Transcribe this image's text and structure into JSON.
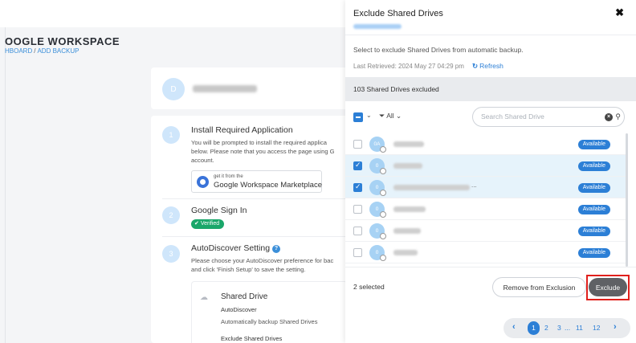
{
  "background": {
    "page_title": "OOGLE WORKSPACE",
    "breadcrumb": {
      "first": "HBOARD",
      "separator": "/",
      "second": "ADD BACKUP"
    },
    "user_avatar": "D",
    "steps": [
      {
        "num": "1",
        "title": "Install Required Application",
        "lines": [
          "You will be prompted to install the required applica",
          "below. Please note that you access the page using G",
          "account."
        ]
      },
      {
        "num": "2",
        "title": "Google Sign In",
        "badge": "Verified"
      },
      {
        "num": "3",
        "title": "AutoDiscover Setting",
        "lines": [
          "Please choose your AutoDiscover preference for bac",
          "and click 'Finish Setup' to save the setting."
        ]
      }
    ],
    "marketplace": {
      "small": "get it from the",
      "big": "Google Workspace Marketplace"
    },
    "shared_drive_card": {
      "title": "Shared Drive",
      "sub": "AutoDiscover",
      "desc": "Automatically backup Shared Drives",
      "exclude_label": "Exclude Shared Drives"
    }
  },
  "dialog": {
    "title": "Exclude Shared Drives",
    "close": "✖",
    "description": "Select to exclude Shared Drives from automatic backup.",
    "last_retrieved": "Last Retrieved: 2024 May 27 04:29 pm",
    "refresh_label": "Refresh",
    "excluded_summary": "103 Shared Drives excluded",
    "filter_label": "All",
    "search": {
      "placeholder": "Search Shared Drive",
      "value": ""
    },
    "rows": [
      {
        "initials": "0A",
        "selected": false,
        "status": "Available"
      },
      {
        "initials": "0",
        "selected": true,
        "status": "Available"
      },
      {
        "initials": "0",
        "selected": true,
        "status": "Available",
        "ellipsis": "..."
      },
      {
        "initials": "0",
        "selected": false,
        "status": "Available"
      },
      {
        "initials": "0",
        "selected": false,
        "status": "Available"
      },
      {
        "initials": "0",
        "selected": false,
        "status": "Available"
      }
    ],
    "selected_count": "2 selected",
    "remove_button": "Remove from Exclusion",
    "exclude_button": "Exclude",
    "pagination": {
      "prev": "‹",
      "pages": [
        "1",
        "2",
        "3",
        "...",
        "11",
        "12"
      ],
      "current": "1",
      "next": "›"
    }
  },
  "colors": {
    "accent": "#2c7fd6",
    "verified": "#1aa76a",
    "highlight": "#e0201c",
    "exclude_button": "#5f6165"
  }
}
